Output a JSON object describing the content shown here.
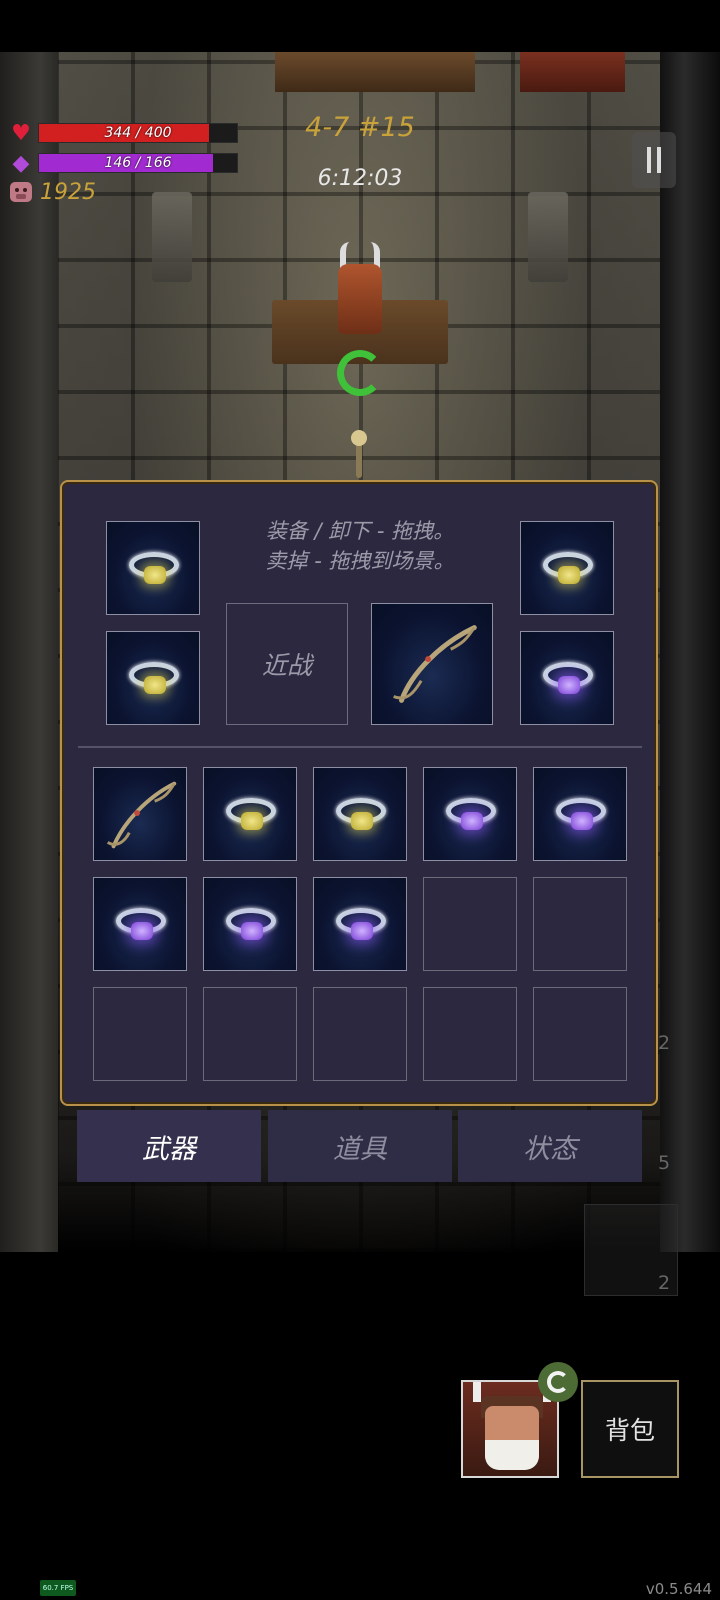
{
  "hud": {
    "hp_text": "344 / 400",
    "hp_fraction": 0.86,
    "mp_text": "146 / 166",
    "mp_fraction": 0.88,
    "gold": "1925",
    "level": "4-7 #15",
    "timer": "6:12:03",
    "colors": {
      "hp": "#d21f1f",
      "mp": "#a12bd1",
      "gold": "#c9a33a"
    }
  },
  "inventory": {
    "instructions_line1": "装备 / 卸下 - 拖拽。",
    "instructions_line2": "卖掉 - 拖拽到场景。",
    "melee_label": "近战",
    "equipped": [
      {
        "slot": "ring-top-left",
        "item": "yellow-ring-icon"
      },
      {
        "slot": "ring-bottom-left",
        "item": "yellow-ring-icon"
      },
      {
        "slot": "melee",
        "item": null
      },
      {
        "slot": "weapon",
        "item": "bow-icon"
      },
      {
        "slot": "ring-top-right",
        "item": "yellow-ring-icon"
      },
      {
        "slot": "ring-bottom-right",
        "item": "purple-ring-icon"
      }
    ],
    "grid": [
      "bow-icon",
      "yellow-ring-icon",
      "yellow-ring-icon",
      "purple-ring-icon",
      "purple-ring-icon",
      "purple-ring-icon",
      "purple-ring-icon",
      "purple-ring-icon",
      null,
      null,
      null,
      null,
      null,
      null,
      null
    ]
  },
  "tabs": [
    {
      "label": "武器",
      "active": true
    },
    {
      "label": "道具",
      "active": false
    },
    {
      "label": "状态",
      "active": false
    }
  ],
  "side_counts": [
    "2",
    "5",
    "2"
  ],
  "backpack_label": "背包",
  "fps": "60.7 FPS",
  "version": "v0.5.644"
}
